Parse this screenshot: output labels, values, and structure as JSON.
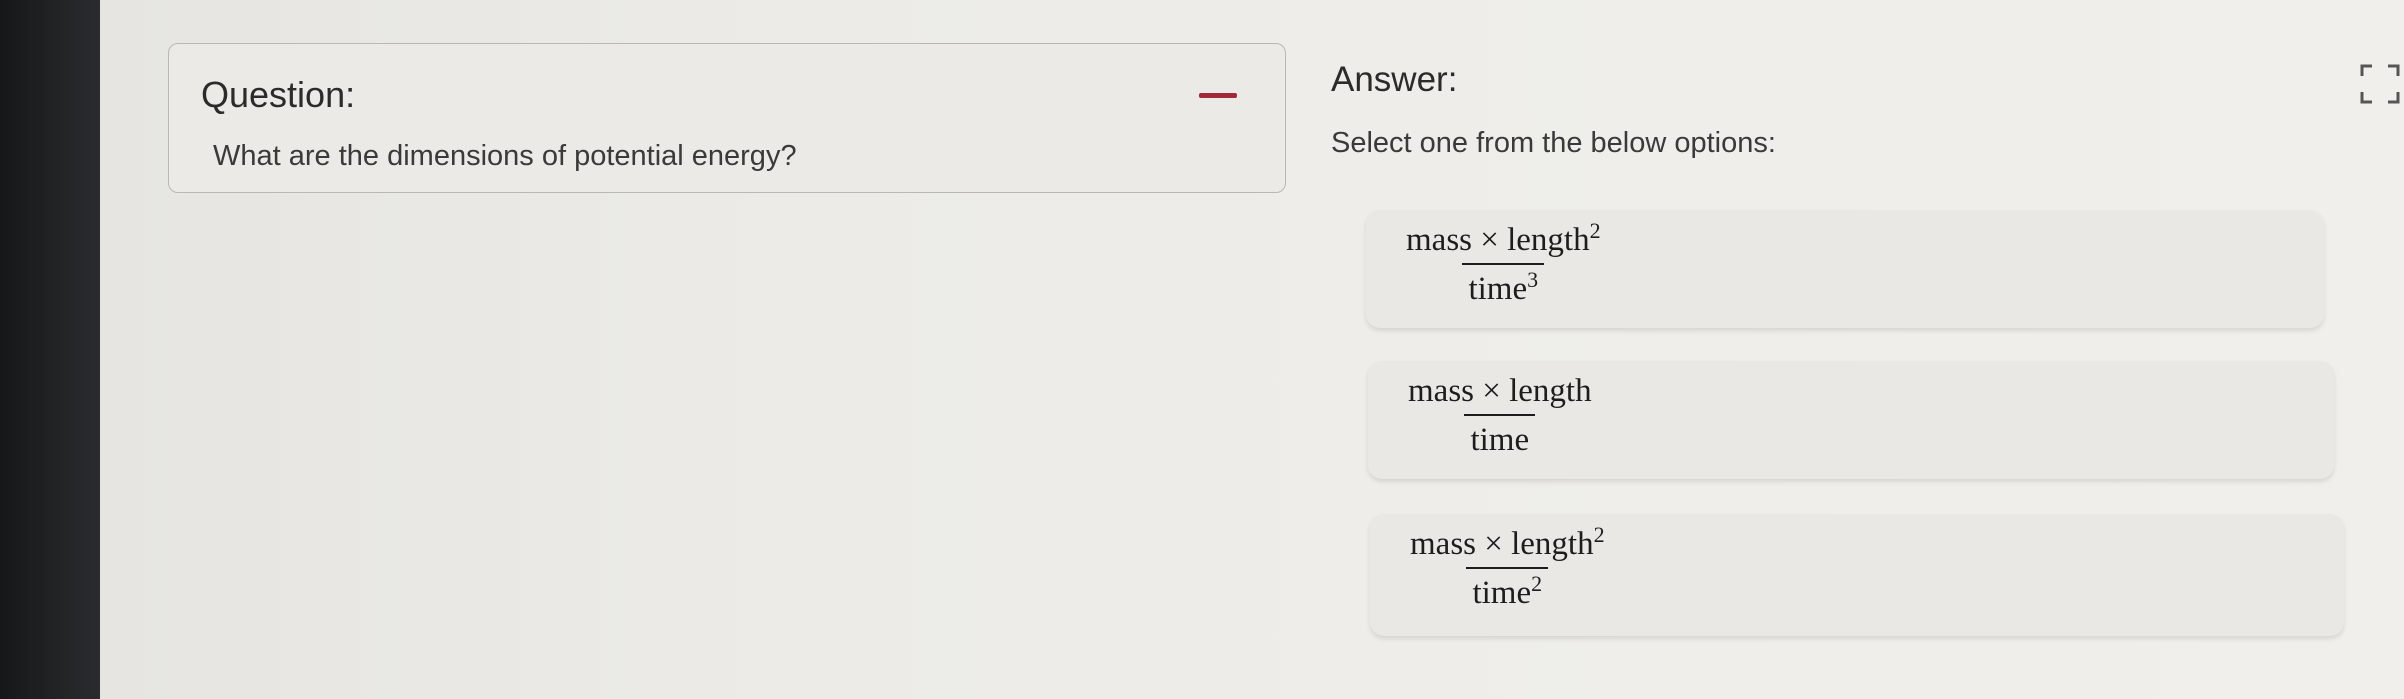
{
  "question": {
    "heading": "Question:",
    "text": "What are the dimensions of potential energy?"
  },
  "answer": {
    "heading": "Answer:",
    "instruction": "Select one from the below options:"
  },
  "options": [
    {
      "numerator": "mass × length",
      "num_exp": "2",
      "denominator": "time",
      "den_exp": "3"
    },
    {
      "numerator": "mass × length",
      "num_exp": "",
      "denominator": "time",
      "den_exp": ""
    },
    {
      "numerator": "mass × length",
      "num_exp": "2",
      "denominator": "time",
      "den_exp": "2"
    }
  ],
  "icons": {
    "collapse": "minus-icon",
    "expand": "fullscreen-icon"
  },
  "colors": {
    "collapse_accent": "#a3283a"
  }
}
